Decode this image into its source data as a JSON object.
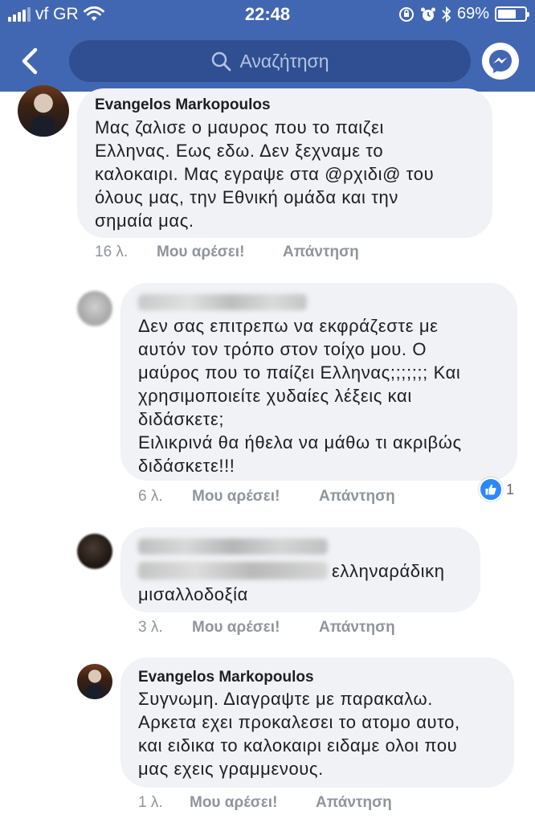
{
  "status_bar": {
    "carrier": "vf GR",
    "time": "22:48",
    "battery": "69%",
    "battery_level": 0.69
  },
  "nav": {
    "back_icon": "chevron-left-icon",
    "search_placeholder": "Αναζήτηση",
    "messenger_icon": "messenger-icon"
  },
  "colors": {
    "header_bg": "#4267b2",
    "bubble_bg": "#f0f2f5",
    "meta_text": "#90949c",
    "like_blue": "#2d88ff"
  },
  "comments": [
    {
      "author": "Evangelos Markopoulos",
      "lines": [
        "Μας ζαλισε ο μαυρος που το παιζει",
        "Ελληνας.  Εως εδω.  Δεν ξεχναμε το",
        "καλοκαιρι.  Μας εγραψε στα @ρχιδι@ του",
        "όλους μας, την Εθνική ομάδα και την",
        "σημαία μας."
      ],
      "time": "16 λ.",
      "like_label": "Μου αρέσει!",
      "reply_label": "Απάντηση"
    },
    {
      "author": "",
      "lines": [
        "Δεν σας επιτρεπω να εκφράζεστε με",
        "αυτόν τον τρόπο στον τοίχο μου. Ο",
        "μαύρος που το παίζει Ελληνας;;;;;;; Και",
        "χρησιμοποιείτε χυδαίες λέξεις και",
        "διδάσκετε;",
        "Ειλικρινά θα ήθελα να μάθω τι ακριβώς",
        "διδάσκετε!!!"
      ],
      "time": "6 λ.",
      "like_label": "Μου αρέσει!",
      "reply_label": "Απάντηση",
      "reaction_count": "1"
    },
    {
      "author": "",
      "tail_text": "ελληναράδικη",
      "lines": [
        "μισαλλοδοξία"
      ],
      "time": "3 λ.",
      "like_label": "Μου αρέσει!",
      "reply_label": "Απάντηση"
    },
    {
      "author": "Evangelos Markopoulos",
      "lines": [
        "Συγνωμη.  Διαγραψτε με παρακαλω.",
        "Αρκετα εχει προκαλεσει το ατομο αυτο,",
        "και ειδικα το καλοκαιρι ειδαμε ολοι που",
        "μας εχεις γραμμενους."
      ],
      "time": "1 λ.",
      "like_label": "Μου αρέσει!",
      "reply_label": "Απάντηση"
    }
  ]
}
